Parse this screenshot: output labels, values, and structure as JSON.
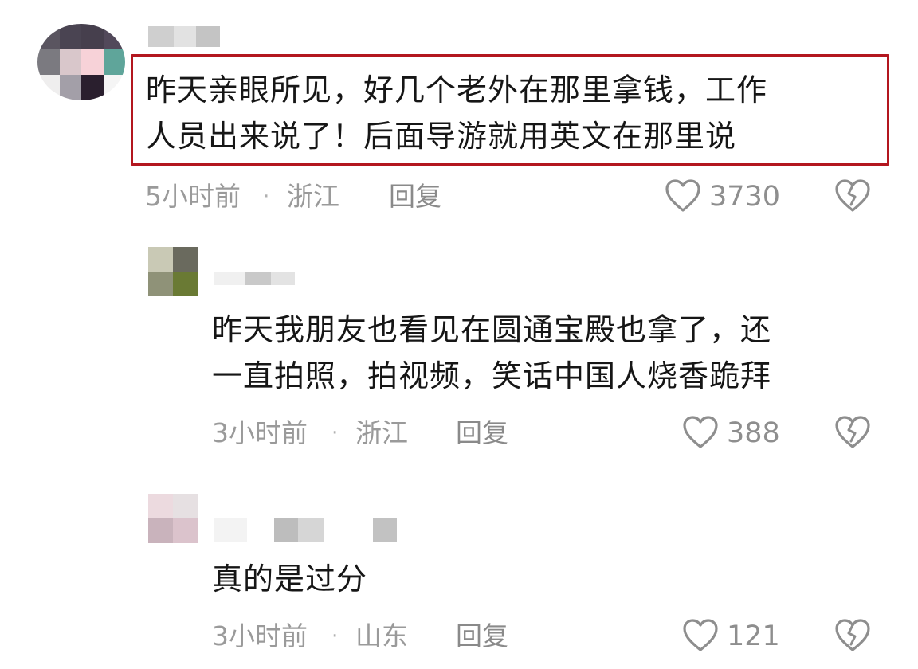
{
  "comments": [
    {
      "text": "昨天亲眼所见，好几个老外在那里拿钱，工作\n人员出来说了！后面导游就用英文在那里说",
      "time": "5小时前",
      "separator": "·",
      "region": "浙江",
      "reply_label": "回复",
      "likes": "3730",
      "highlighted": true
    },
    {
      "text": "昨天我朋友也看见在圆通宝殿也拿了，还\n一直拍照，拍视频，笑话中国人烧香跪拜",
      "time": "3小时前",
      "separator": "·",
      "region": "浙江",
      "reply_label": "回复",
      "likes": "388",
      "highlighted": false
    },
    {
      "text": "真的是过分",
      "time": "3小时前",
      "separator": "·",
      "region": "山东",
      "reply_label": "回复",
      "likes": "121",
      "highlighted": false
    }
  ],
  "icons": {
    "like": "heart-outline-icon",
    "dislike": "broken-heart-icon"
  },
  "colors": {
    "highlight_border": "#b3171f",
    "meta_text": "#9a9a9a",
    "comment_text": "#161616"
  }
}
